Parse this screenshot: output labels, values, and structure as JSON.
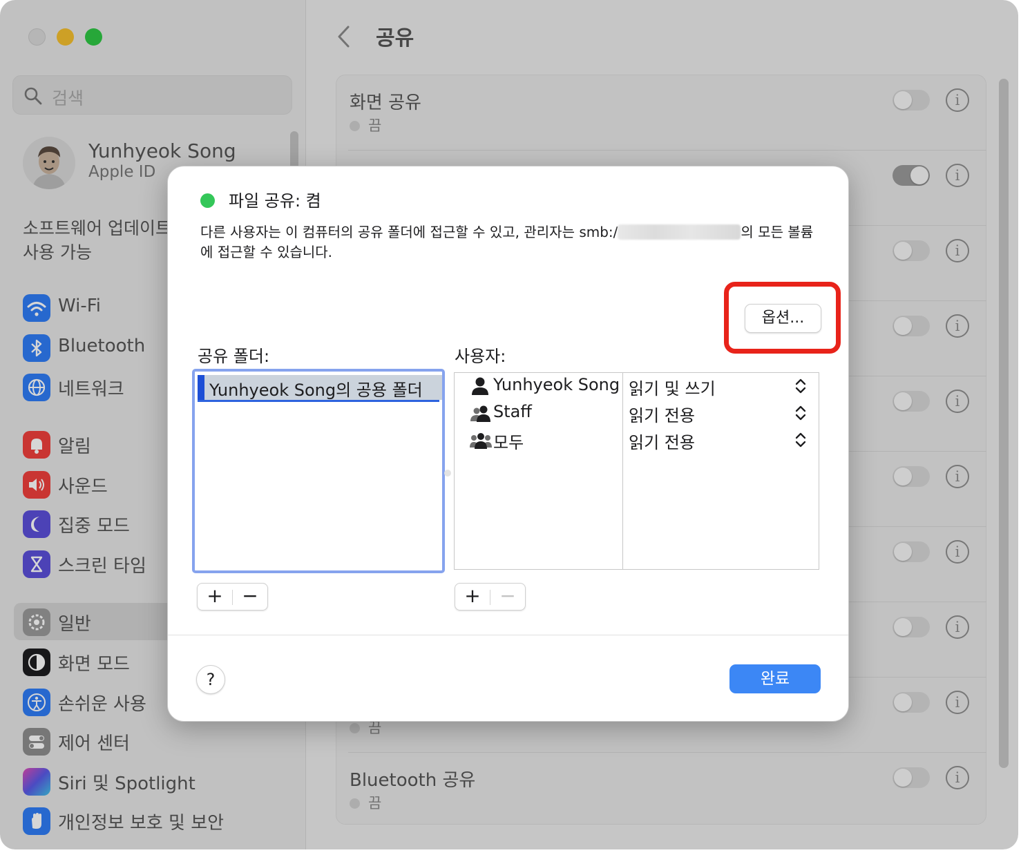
{
  "search": {
    "placeholder": "검색"
  },
  "profile": {
    "name": "Yunhyeok Song",
    "subtitle": "Apple ID"
  },
  "sidebar": {
    "software_update": [
      "소프트웨어 업데이트",
      "사용 가능"
    ],
    "items": [
      {
        "label": "Wi-Fi",
        "icon": "wifi-icon",
        "color": "#2f7cf6"
      },
      {
        "label": "Bluetooth",
        "icon": "bluetooth-icon",
        "color": "#2f7cf6"
      },
      {
        "label": "네트워크",
        "icon": "globe-icon",
        "color": "#2f7cf6"
      },
      {
        "label": "알림",
        "icon": "bell-icon",
        "color": "#f0403c"
      },
      {
        "label": "사운드",
        "icon": "speaker-icon",
        "color": "#f0403c"
      },
      {
        "label": "집중 모드",
        "icon": "moon-icon",
        "color": "#5b4fd9"
      },
      {
        "label": "스크린 타임",
        "icon": "hourglass-icon",
        "color": "#5b4fd9"
      },
      {
        "label": "일반",
        "icon": "gear-icon",
        "color": "#9a9a9a"
      },
      {
        "label": "화면 모드",
        "icon": "appearance-icon",
        "color": "#1d1d1f"
      },
      {
        "label": "손쉬운 사용",
        "icon": "accessibility-icon",
        "color": "#2f7cf6"
      },
      {
        "label": "제어 센터",
        "icon": "control-center-icon",
        "color": "#8e8e8e"
      },
      {
        "label": "Siri 및 Spotlight",
        "icon": "siri-icon",
        "color": "#7a4fd9"
      },
      {
        "label": "개인정보 보호 및 보안",
        "icon": "hand-icon",
        "color": "#2f7cf6"
      }
    ]
  },
  "main": {
    "title": "공유",
    "rows": [
      {
        "title": "화면 공유",
        "status": "끔",
        "on": false
      },
      {
        "title": "",
        "status": "",
        "on": true
      },
      {
        "title": "",
        "status": "",
        "on": false
      },
      {
        "title": "",
        "status": "",
        "on": false
      },
      {
        "title": "",
        "status": "",
        "on": false
      },
      {
        "title": "",
        "status": "",
        "on": false
      },
      {
        "title": "",
        "status": "",
        "on": false
      },
      {
        "title": "",
        "status": "",
        "on": false
      },
      {
        "title": "",
        "status": "끔",
        "on": false
      },
      {
        "title": "Bluetooth 공유",
        "status": "끔",
        "on": false
      }
    ]
  },
  "sheet": {
    "title": "파일 공유: 켬",
    "desc_before": "다른 사용자는 이 컴퓨터의 공유 폴더에 접근할 수 있고, 관리자는 smb:/",
    "desc_after": "의 모든 볼륨에 접근할 수 있습니다.",
    "options_label": "옵션...",
    "folders_label": "공유 폴더:",
    "users_label": "사용자:",
    "folders": [
      "Yunhyeok Song의 공용 폴더"
    ],
    "users": [
      {
        "name": "Yunhyeok Song",
        "permission": "읽기 및 쓰기",
        "icon": "person-icon"
      },
      {
        "name": "Staff",
        "permission": "읽기 전용",
        "icon": "group-icon"
      },
      {
        "name": "모두",
        "permission": "읽기 전용",
        "icon": "everyone-icon"
      }
    ],
    "plus": "+",
    "minus": "−",
    "help": "?",
    "done_label": "완료",
    "accent": "#3c87f5",
    "highlight_color": "#e8231a"
  }
}
